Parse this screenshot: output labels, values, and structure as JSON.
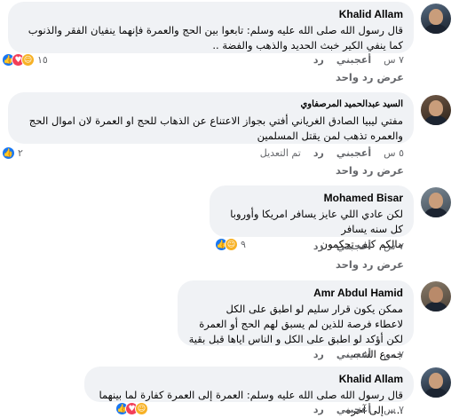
{
  "comments": [
    {
      "author": "Khalid Allam",
      "text": "قال رسول الله صلى الله عليه وسلم: تابعوا بين الحج والعمرة فإنهما ينفيان الفقر والذنوب كما ينفي الكير خبث الحديد والذهب والفضة ..",
      "time": "٧ س",
      "like_label": "أعجبني",
      "reply_label": "رد",
      "reaction_count": "١٥",
      "reactions": [
        "like",
        "love",
        "haha"
      ]
    },
    {
      "author": "السيد عبدالحميد المرصفاوي",
      "text": "مفتي ليبيا الصادق الغرياني أفتي بجواز الاعتناع عن الذهاب للحج او العمرة لان اموال الحج والعمره تذهب لمن يقتل المسلمين",
      "time": "٥ س",
      "like_label": "أعجبني",
      "reply_label": "رد",
      "edited_label": "تم التعديل",
      "reaction_count": "٢",
      "reactions": [
        "like"
      ]
    },
    {
      "author": "Mohamed Bisar",
      "text": "لكن عادي اللي عايز يسافر امريكا وأوروبا كل سنه يسافر\nمالكم كيف تحكمون",
      "time": "٧ س",
      "like_label": "أعجبني",
      "reply_label": "رد",
      "reaction_count": "٩",
      "reactions": [
        "like",
        "haha"
      ]
    },
    {
      "author": "Amr Abdul Hamid",
      "text": "ممكن يكون قرار سليم لو اطبق على الكل\nلاعطاء فرصة للذين لم يسبق لهم الحج أو العمرة\nلكن أؤكد لو اطبق على الكل و الناس اياها قبل بقية جموع الشعب",
      "time": "٧ س",
      "like_label": "أعجبني",
      "reply_label": "رد",
      "reaction_count": "",
      "reactions": []
    },
    {
      "author": "Khalid Allam",
      "text": "قال رسول الله صلى الله عليه وسلم: العمرة إلى العمرة كفارة لما بينهما ..... إلى آخره",
      "time": "٧ س",
      "like_label": "أعجبني",
      "reply_label": "رد",
      "reaction_count": "",
      "reactions": [
        "like",
        "love",
        "haha"
      ]
    }
  ],
  "view_one_reply": "عرض رد واحد",
  "colors": {
    "like": "#1877f2",
    "love": "#f33e58",
    "haha": "#f7b125",
    "bubble": "#f0f2f5",
    "meta": "#65676b"
  }
}
